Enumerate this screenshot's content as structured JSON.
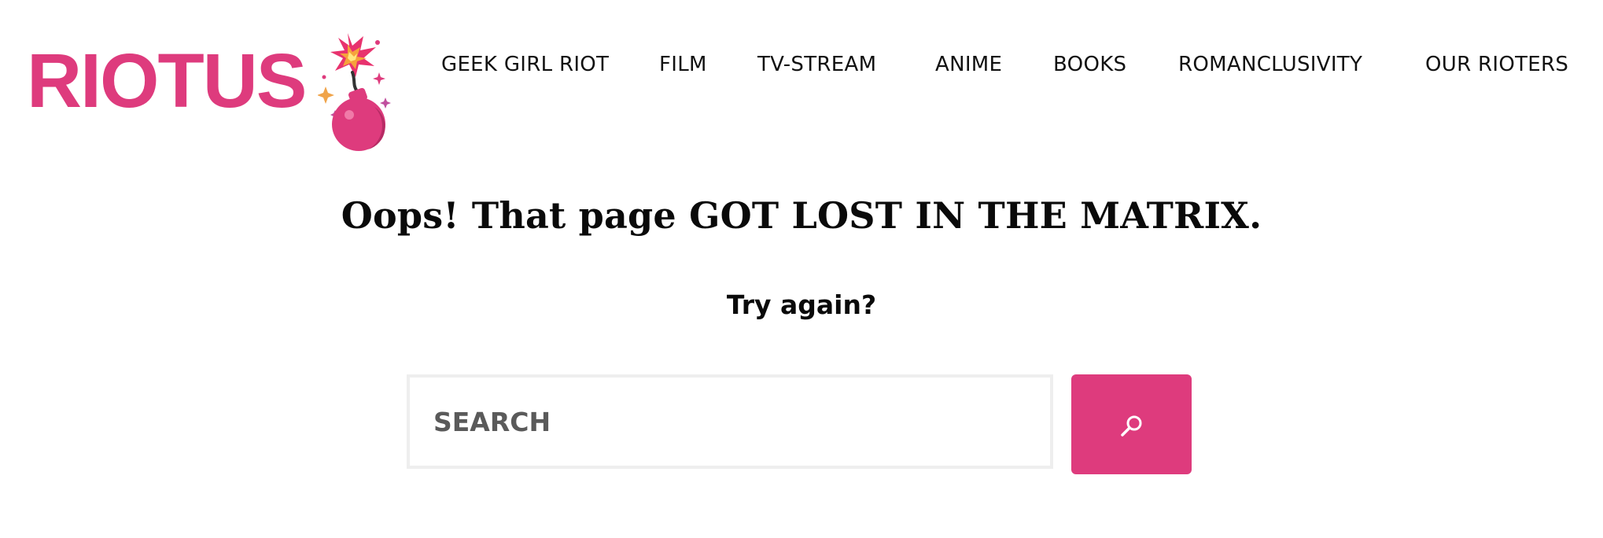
{
  "colors": {
    "brand_pink": "#de3b7d",
    "text": "#0a0a0a",
    "input_border": "#eeeeee",
    "placeholder": "#5a5a5a"
  },
  "header": {
    "logo_text": "RIOTUS",
    "logo_icon": "bomb-icon",
    "nav": [
      {
        "label": "GEEK GIRL RIOT"
      },
      {
        "label": "FILM"
      },
      {
        "label": "TV-STREAM"
      },
      {
        "label": "ANIME"
      },
      {
        "label": "BOOKS"
      },
      {
        "label": "ROMANCLUSIVITY"
      },
      {
        "label": "OUR RIOTERS"
      }
    ]
  },
  "main": {
    "headline": "Oops! That page GOT LOST IN THE MATRIX.",
    "subhead": "Try again?",
    "search": {
      "placeholder": "SEARCH",
      "value": "",
      "button_icon": "search-icon"
    }
  }
}
